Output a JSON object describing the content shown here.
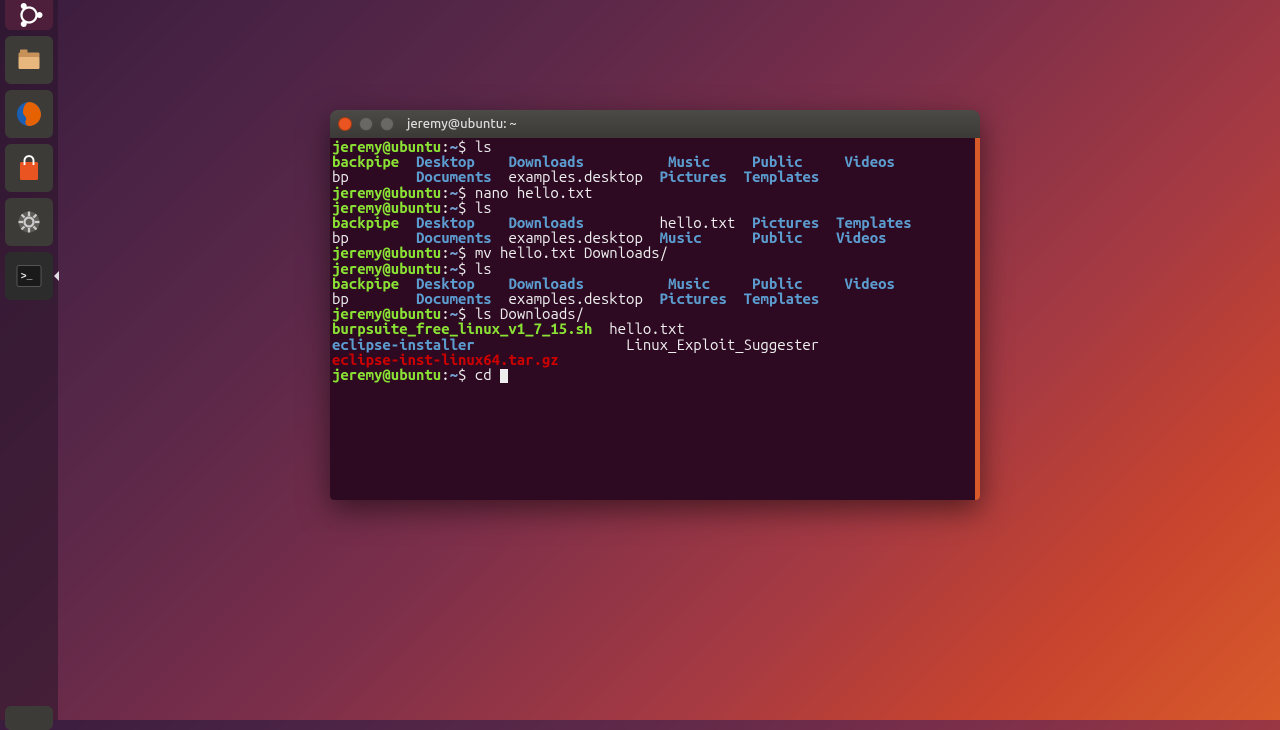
{
  "launcher": {
    "items": [
      {
        "name": "ubuntu-dash",
        "label": "Dash"
      },
      {
        "name": "files",
        "label": "Files"
      },
      {
        "name": "firefox",
        "label": "Firefox"
      },
      {
        "name": "software",
        "label": "Ubuntu Software"
      },
      {
        "name": "settings",
        "label": "System Settings"
      },
      {
        "name": "terminal",
        "label": "Terminal"
      }
    ]
  },
  "window": {
    "title": "jeremy@ubuntu: ~"
  },
  "terminal": {
    "prompt_user": "jeremy@ubuntu",
    "prompt_path": "~",
    "prompt_sep": ":",
    "prompt_end": "$",
    "history": [
      {
        "cmd": "ls"
      },
      {
        "cmd": "nano hello.txt"
      },
      {
        "cmd": "ls"
      },
      {
        "cmd": "mv hello.txt Downloads/"
      },
      {
        "cmd": "ls"
      },
      {
        "cmd": "ls Downloads/"
      }
    ],
    "ls1": {
      "backpipe": "backpipe",
      "Desktop": "Desktop",
      "Downloads": "Downloads",
      "Music": "Music",
      "Public": "Public",
      "Videos": "Videos",
      "bp": "bp",
      "Documents": "Documents",
      "examples": "examples.desktop",
      "Pictures": "Pictures",
      "Templates": "Templates"
    },
    "ls2": {
      "backpipe": "backpipe",
      "Desktop": "Desktop",
      "Downloads": "Downloads",
      "hello": "hello.txt",
      "Pictures": "Pictures",
      "Templates": "Templates",
      "bp": "bp",
      "Documents": "Documents",
      "examples": "examples.desktop",
      "Music": "Music",
      "Public": "Public",
      "Videos": "Videos"
    },
    "ls3": {
      "backpipe": "backpipe",
      "Desktop": "Desktop",
      "Downloads": "Downloads",
      "Music": "Music",
      "Public": "Public",
      "Videos": "Videos",
      "bp": "bp",
      "Documents": "Documents",
      "examples": "examples.desktop",
      "Pictures": "Pictures",
      "Templates": "Templates"
    },
    "lsD": {
      "burp": "burpsuite_free_linux_v1_7_15.sh",
      "hello": "hello.txt",
      "eclipse_inst": "eclipse-installer",
      "linux_exp": "Linux_Exploit_Suggester",
      "eclipse_tar": "eclipse-inst-linux64.tar.gz"
    },
    "current_cmd": "cd "
  }
}
